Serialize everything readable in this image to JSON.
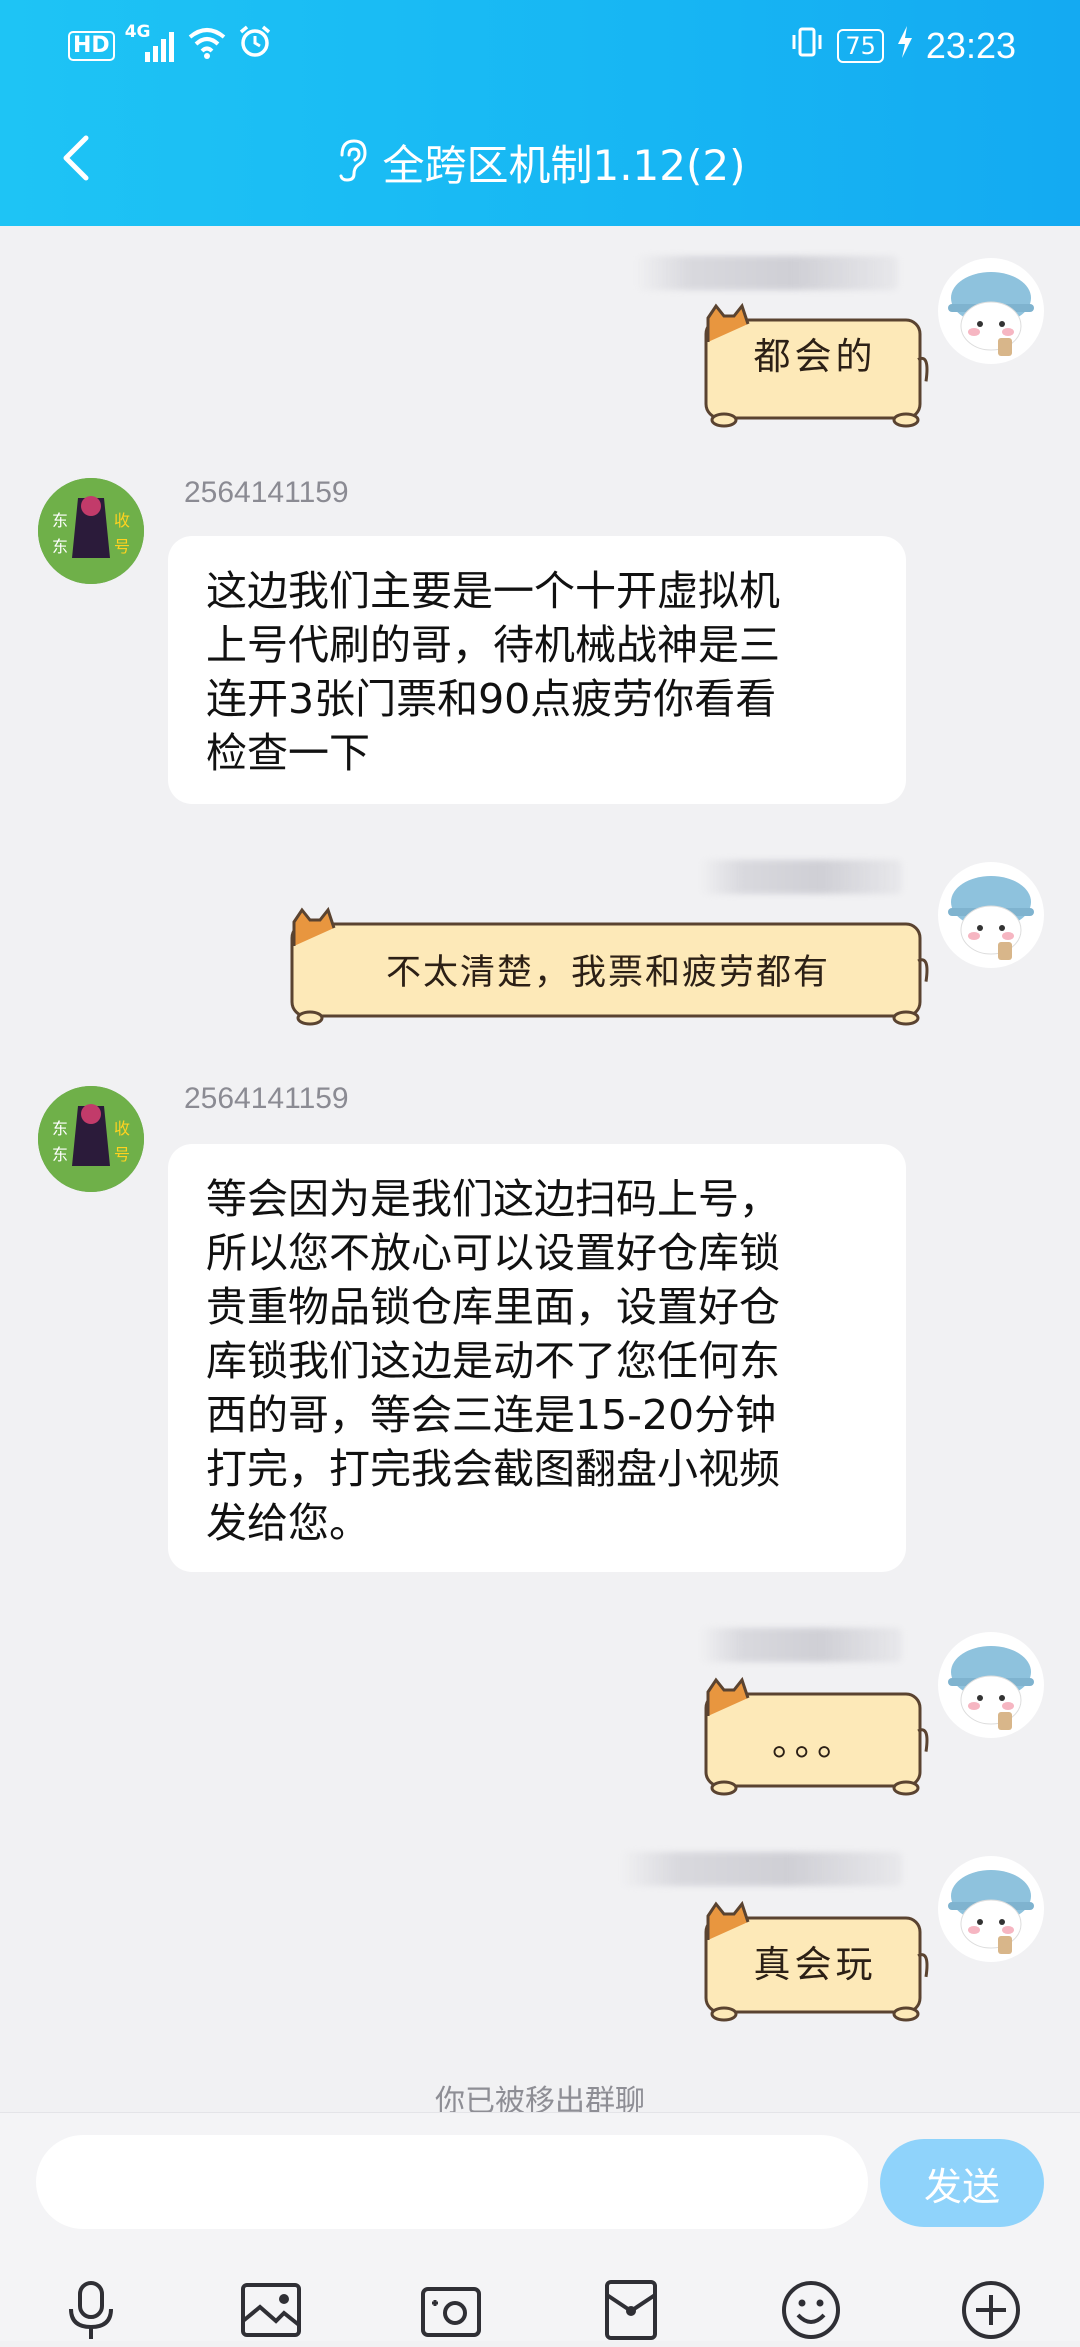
{
  "status_bar": {
    "hd": "HD",
    "signal": "4G",
    "battery": "75",
    "time": "23:23"
  },
  "header": {
    "title": "全跨区机制1.12(2)",
    "back_icon": "chevron-left-icon",
    "mode_icon": "ear-icon",
    "bg_color": "#16b4f4"
  },
  "messages": [
    {
      "from": "me",
      "type": "sticker",
      "text": "都会的"
    },
    {
      "from": "other",
      "sender": "2564141159",
      "type": "text",
      "lines": [
        "这边我们主要是一个十开虚拟机",
        "上号代刷的哥，待机械战神是三",
        "连开3张门票和90点疲劳你看看",
        "检查一下"
      ]
    },
    {
      "from": "me",
      "type": "sticker",
      "text": "不太清楚，我票和疲劳都有"
    },
    {
      "from": "other",
      "sender": "2564141159",
      "type": "text",
      "lines": [
        "等会因为是我们这边扫码上号，",
        "所以您不放心可以设置好仓库锁",
        "贵重物品锁仓库里面，设置好仓",
        "库锁我们这边是动不了您任何东",
        "西的哥，等会三连是15-20分钟",
        "打完，打完我会截图翻盘小视频",
        "发给您。"
      ]
    },
    {
      "from": "me",
      "type": "sticker",
      "text": "。。。"
    },
    {
      "from": "me",
      "type": "sticker",
      "text": "真会玩"
    }
  ],
  "notice": "你已被移出群聊",
  "input": {
    "value": "",
    "placeholder": "",
    "send_label": "发送"
  },
  "toolbar": [
    "microphone-icon",
    "image-icon",
    "camera-icon",
    "red-packet-icon",
    "emoji-icon",
    "plus-circle-icon"
  ]
}
